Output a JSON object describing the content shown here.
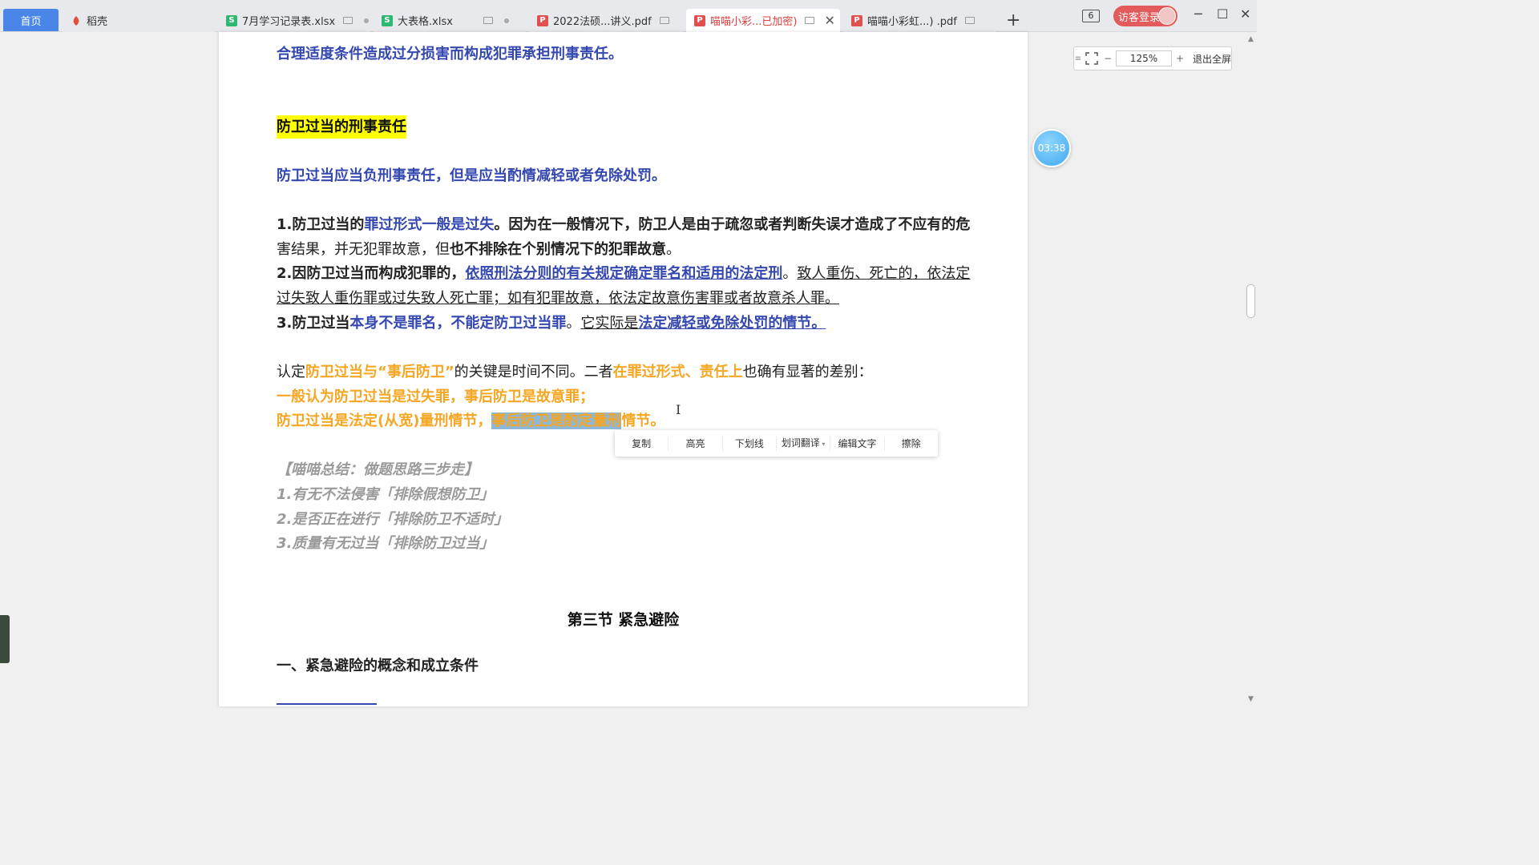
{
  "tabs": {
    "home": "首页",
    "items": [
      {
        "label": "稻壳",
        "icon": "daoke-icon"
      },
      {
        "label": "7月学习记录表.xlsx",
        "icon": "sheet-icon"
      },
      {
        "label": "大表格.xlsx",
        "icon": "sheet-icon"
      },
      {
        "label": "2022法硕...讲义.pdf",
        "icon": "pdf-icon"
      },
      {
        "label": "喵喵小彩...已加密)",
        "icon": "pdf-icon"
      },
      {
        "label": "喵喵小彩虹...) .pdf",
        "icon": "pdf-icon"
      }
    ]
  },
  "topbar": {
    "window_count": "6",
    "login_label": "访客登录"
  },
  "zoom": {
    "value": "125%",
    "exit_label": "退出全屏"
  },
  "timer": "03:38",
  "doc": {
    "top_line": "合理适度条件造成过分损害而构成犯罪承担刑事责任。",
    "heading": "防卫过当的刑事责任",
    "intro": "防卫过当应当负刑事责任，但是应当酌情减轻或者免除处罚。",
    "p1_a": "1.防卫过当的",
    "p1_b": "罪过形式一般是过失",
    "p1_c": "。因为在一般情况下，防卫人是由于疏忽或者判断失误才造成了不应有的危",
    "p1_d": "害结果，并无犯罪故意，但",
    "p1_e": "也不排除在个别情况下的犯罪故意",
    "p1_f": "。",
    "p2_a": "2.因防卫过当而构成犯罪的，",
    "p2_b": "依照刑法分则的有关规定确定罪名和适用的法定刑",
    "p2_c": "。",
    "p2_d": "致人重伤、死亡的，依法定",
    "p2_e": "过失致人重伤罪或过失致人死亡罪；如有犯罪故意，依法定故意伤害罪或者故意杀人罪。",
    "p3_a": "3.防卫过当",
    "p3_b": "本身不是罪名，不能定防卫过当罪",
    "p3_c": "。",
    "p3_d": "它实际是",
    "p3_e": "法定减轻或免除处罚的情节。",
    "c1_a": "认定",
    "c1_b": "防卫过当与“事后防卫”",
    "c1_c": "的关键是时间不同。二者",
    "c1_d": "在罪过形式、责任上",
    "c1_e": "也确有显著的差别：",
    "c2": "一般认为防卫过当是过失罪，事后防卫是故意罪；",
    "c3_a": "防卫过当是法定(从宽)量刑情节，",
    "c3_b": "事后防卫是酌定量刑",
    "c3_c": "情节。",
    "s1": "【喵喵总结：做题思路三步走】",
    "s2": "1.有无不法侵害「排除假想防卫」",
    "s3": "2.是否正在进行「排除防卫不适时」",
    "s4": "3.质量有无过当「排除防卫过当」",
    "section": "第三节  紧急避险",
    "subsection": "一、紧急避险的概念和成立条件"
  },
  "context_menu": [
    "复制",
    "高亮",
    "下划线",
    "划词翻译",
    "编辑文字",
    "擦除"
  ]
}
